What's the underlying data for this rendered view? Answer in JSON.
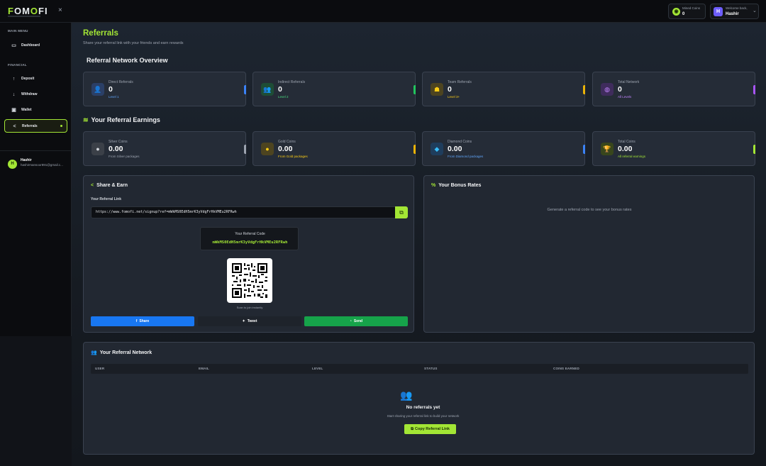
{
  "brand": {
    "logo_a": "F",
    "logo_b": "O",
    "logo_c": "M",
    "logo_d": "O",
    "logo_e": "FI",
    "close": "×"
  },
  "topbar": {
    "coins_label": "Mined Coins",
    "coins_value": "0",
    "welcome": "Welcome back,",
    "user": "Hashir",
    "avatar": "H"
  },
  "sidebar": {
    "main_menu": "MAIN MENU",
    "financial": "FINANCIAL",
    "items": [
      {
        "label": "Dashboard",
        "icon": "monitor-icon"
      },
      {
        "label": "Deposit",
        "icon": "arrow-up-icon"
      },
      {
        "label": "Withdraw",
        "icon": "arrow-down-icon"
      },
      {
        "label": "Wallet",
        "icon": "wallet-icon"
      },
      {
        "label": "Referrals",
        "icon": "share-icon"
      }
    ],
    "user_name": "Hashir",
    "user_email": "hashirmansoor891@gmail.c...",
    "user_initial": "H"
  },
  "page": {
    "title": "Referrals",
    "subtitle": "Share your referral link with your friends and earn rewards"
  },
  "overview": {
    "title": "Referral Network Overview",
    "cards": [
      {
        "label": "Direct Referrals",
        "value": "0",
        "sub": "Level 1",
        "color": "#3b82f6"
      },
      {
        "label": "Indirect Referrals",
        "value": "0",
        "sub": "Level 2",
        "color": "#22c55e"
      },
      {
        "label": "Team Referrals",
        "value": "0",
        "sub": "Level 3+",
        "color": "#eab308"
      },
      {
        "label": "Total Network",
        "value": "0",
        "sub": "All Levels",
        "color": "#a855f7"
      }
    ]
  },
  "earnings": {
    "title": "Your Referral Earnings",
    "cards": [
      {
        "label": "Silver Coins",
        "value": "0.00",
        "sub": "From Silver packages",
        "color": "#9ca3af"
      },
      {
        "label": "Gold Coins",
        "value": "0.00",
        "sub": "From Gold packages",
        "color": "#eab308"
      },
      {
        "label": "Diamond Coins",
        "value": "0.00",
        "sub": "From Diamond packages",
        "color": "#3b82f6"
      },
      {
        "label": "Total Coins",
        "value": "0.00",
        "sub": "All referral earnings",
        "color": "#a3e635"
      }
    ]
  },
  "share": {
    "title": "Share & Earn",
    "link_label": "Your Referral Link",
    "link": "https://www.fomofi.net/signup?ref=mWkMS0EdH5mrK3yVdgFrHkVMEu2RFRwh",
    "code_label": "Your Referral Code",
    "code": "mWkMS0EdH5mrK3yVdgFrHkVMEu2RFRwh",
    "qr_caption": "Scan to join instantly",
    "btn_share": "Share",
    "btn_tweet": "Tweet",
    "btn_send": "Send"
  },
  "bonus": {
    "title": "Your Bonus Rates",
    "message": "Generate a referral code to see your bonus rates"
  },
  "network": {
    "title": "Your Referral Network",
    "columns": [
      "USER",
      "EMAIL",
      "LEVEL",
      "STATUS",
      "COINS EARNED"
    ],
    "empty_title": "No referrals yet",
    "empty_sub": "Start sharing your referral link to build your network",
    "copy_btn": "Copy Referral Link"
  }
}
